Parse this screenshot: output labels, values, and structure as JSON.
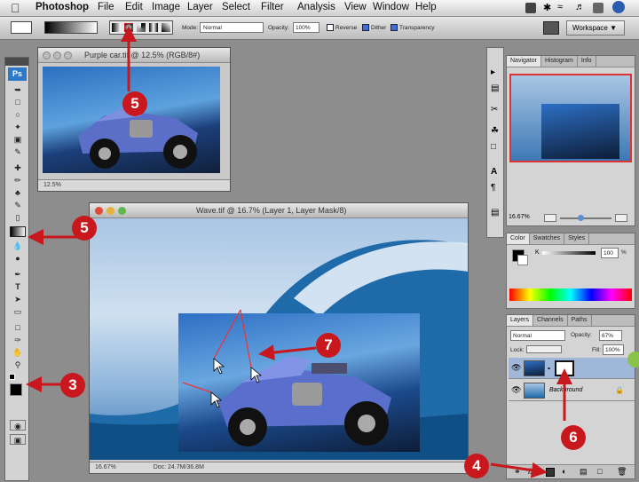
{
  "menubar": {
    "app_name": "Photoshop",
    "items": [
      "File",
      "Edit",
      "Image",
      "Layer",
      "Select",
      "Filter",
      "Analysis",
      "View",
      "Window",
      "Help"
    ]
  },
  "options_bar": {
    "mode_label": "Mode:",
    "mode_value": "Normal",
    "opacity_label": "Opacity:",
    "opacity_value": "100%",
    "reverse_label": "Reverse",
    "dither_label": "Dither",
    "transparency_label": "Transparency",
    "workspace_label": "Workspace"
  },
  "toolbox": {
    "logo": "Ps"
  },
  "doc_small": {
    "title": "Purple car.tif @ 12.5% (RGB/8#)",
    "zoom": "12.5%"
  },
  "doc_main": {
    "title": "Wave.tif @ 16.7% (Layer 1, Layer Mask/8)",
    "zoom": "16.67%",
    "doc_info": "Doc: 24.7M/36.8M"
  },
  "navigator": {
    "tabs": [
      "Navigator",
      "Histogram",
      "Info"
    ],
    "zoom": "16.67%"
  },
  "color_panel": {
    "tabs": [
      "Color",
      "Swatches",
      "Styles"
    ],
    "channel_label": "K",
    "channel_value": "100",
    "unit": "%"
  },
  "layers_panel": {
    "tabs": [
      "Layers",
      "Channels",
      "Paths"
    ],
    "blend_mode": "Normal",
    "opacity_label": "Opacity:",
    "opacity_value": "67%",
    "lock_label": "Lock:",
    "fill_label": "Fill:",
    "fill_value": "100%",
    "background_layer_name": "Background"
  },
  "callouts": [
    "3",
    "4",
    "5",
    "5",
    "6",
    "7"
  ],
  "colors": {
    "callout_red": "#c8181d",
    "accent_green": "#8bc34a"
  }
}
